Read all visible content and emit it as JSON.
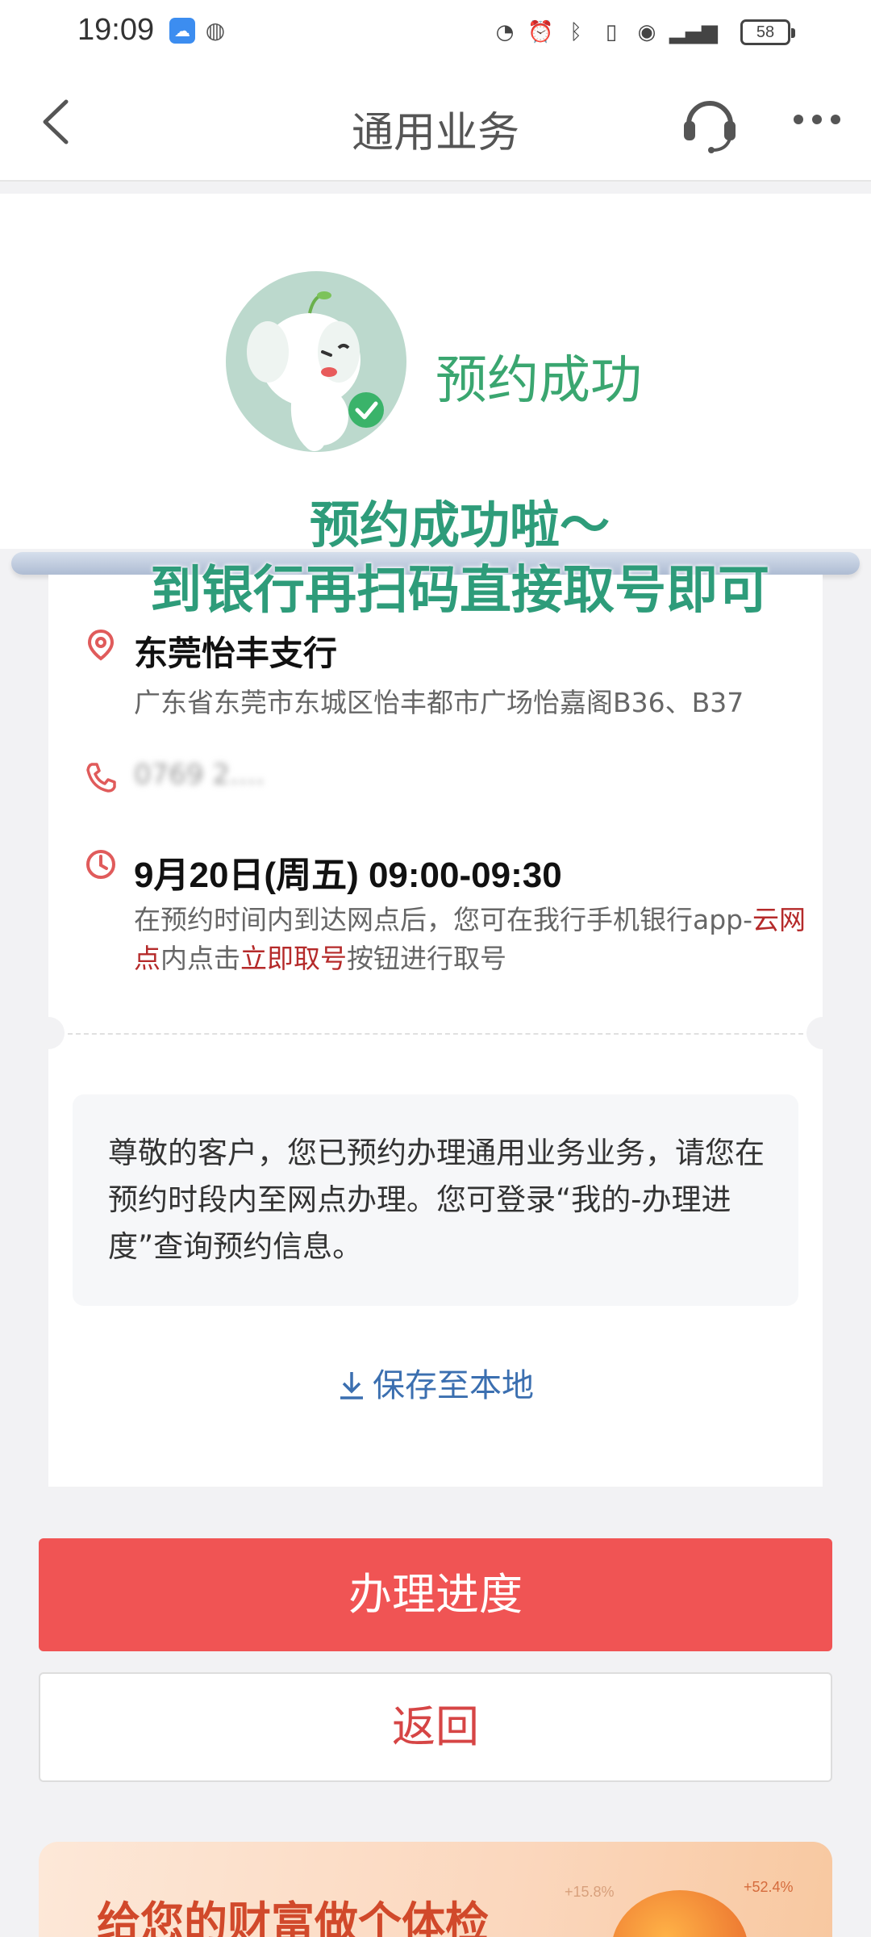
{
  "status_bar": {
    "time": "19:09",
    "battery": "58",
    "icons": [
      "speedometer-icon",
      "alarm-icon",
      "bluetooth-icon",
      "vibrate-icon",
      "hotspot-icon",
      "4g-signal-icon"
    ]
  },
  "nav": {
    "title": "通用业务"
  },
  "hero": {
    "success_title": "预约成功",
    "overlay_line1": "预约成功啦～",
    "overlay_line2": "到银行再扫码直接取号即可"
  },
  "branch": {
    "name": "东莞怡丰支行",
    "address": "广东省东莞市东城区怡丰都市广场怡嘉阁B36、B37",
    "phone": "0769 2...."
  },
  "appointment": {
    "time": "9月20日(周五) 09:00-09:30",
    "desc_part1": "在预约时间内到达网点后，您可在我行手机银行app-",
    "desc_red1": "云网点",
    "desc_part2": "内点击",
    "desc_red2": "立即取号",
    "desc_part3": "按钮进行取号"
  },
  "notice": {
    "text": "尊敬的客户，您已预约办理通用业务业务，请您在预约时段内至网点办理。您可登录“我的-办理进度”查询预约信息。"
  },
  "actions": {
    "save_label": "保存至本地",
    "progress_label": "办理进度",
    "back_label": "返回"
  },
  "banner": {
    "title": "给您的财富做个体检",
    "stat1": "+15.8%",
    "stat2": "+52.4%"
  },
  "colors": {
    "primary_red": "#f05454",
    "success_green": "#3aa670",
    "link_blue": "#3b6fb0"
  }
}
